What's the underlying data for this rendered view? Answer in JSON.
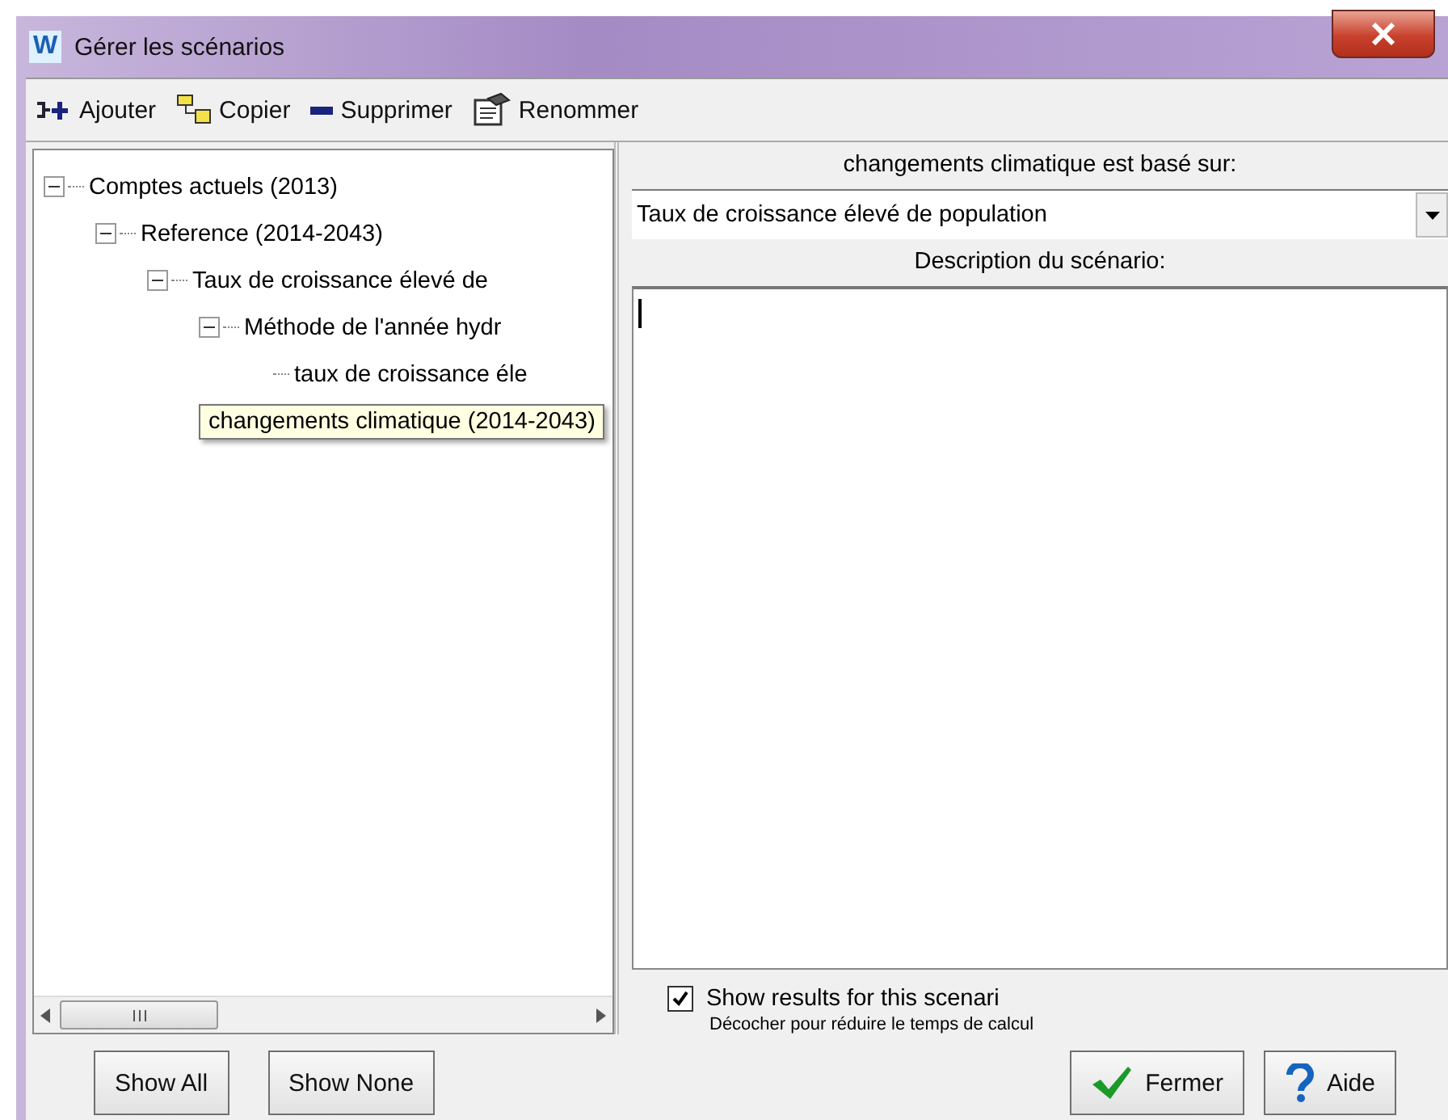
{
  "window": {
    "title": "Gérer les scénarios",
    "icon_letter": "W"
  },
  "toolbar": [
    {
      "kind": "add",
      "label": "Ajouter"
    },
    {
      "kind": "copy",
      "label": "Copier"
    },
    {
      "kind": "delete",
      "label": "Supprimer"
    },
    {
      "kind": "rename",
      "label": "Renommer"
    }
  ],
  "tree": [
    {
      "label": "Comptes actuels (2013)",
      "expanded": true,
      "children": [
        {
          "label": "Reference (2014-2043)",
          "expanded": true,
          "children": [
            {
              "label": "Taux de croissance élevé de",
              "expanded": true,
              "children": [
                {
                  "label": "Méthode de l'année hydr",
                  "expanded": true,
                  "children": [
                    {
                      "label": "taux de croissance éle"
                    }
                  ]
                },
                {
                  "label": "changements climatique (2014-2043)",
                  "tooltip": true
                }
              ]
            }
          ]
        }
      ]
    }
  ],
  "based_on": {
    "label": "changements climatique est basé sur:",
    "value": "Taux de croissance élevé de population"
  },
  "description": {
    "label": "Description du scénario:"
  },
  "show_results": {
    "label": "Show results for this scenari",
    "checked": true,
    "hint": "Décocher pour réduire le temps de calcul"
  },
  "left_buttons": [
    "Show All",
    "Show None"
  ],
  "right_buttons": [
    {
      "kind": "close",
      "label": "Fermer"
    },
    {
      "kind": "help",
      "label": "Aide"
    }
  ]
}
